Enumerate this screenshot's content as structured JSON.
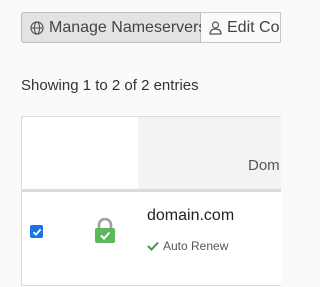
{
  "toolbar": {
    "manage_nameservers_label": "Manage Nameservers",
    "manage_nameservers_icon": "globe-icon",
    "edit_label": "Edit Co",
    "edit_icon": "user-icon"
  },
  "entries_info": "Showing 1 to 2 of 2 entries",
  "table": {
    "columns": [
      {
        "label": "Dom"
      }
    ],
    "rows": [
      {
        "checked": true,
        "ssl_icon": "lock-icon",
        "domain": "domain.com",
        "status": "Auto Renew",
        "status_icon": "check-icon"
      }
    ]
  },
  "colors": {
    "accent": "#1a73e8",
    "lock": "#5cb85c",
    "check": "#3c9a3c"
  }
}
